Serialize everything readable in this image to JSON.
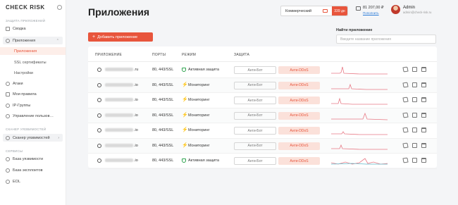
{
  "brand": {
    "logo_left": "CHECK",
    "logo_dot": " ",
    "logo_right": "RISK"
  },
  "sidebar": {
    "section_apps": "ЗАЩИТА ПРИЛОЖЕНИЙ",
    "section_scanner": "СКАНЕР УЯЗВИМОСТЕЙ",
    "section_services": "СЕРВИСЫ",
    "items": {
      "summary": "Сводка",
      "apps": "Приложения",
      "apps_sub": "Приложения",
      "ssl": "SSL сертификаты",
      "settings": "Настройки",
      "attacks": "Атаки",
      "rules": "Мои правила",
      "ip_groups": "IP-Группы",
      "user_mgmt": "Управление пользов…",
      "scanner": "Сканер уязвимостей",
      "vuln_db": "База уязвимости",
      "exploit_db": "База эксплоитов",
      "eol": "EOL"
    }
  },
  "header": {
    "title": "Приложения",
    "plan": "Коммерческий",
    "days": "339 дн",
    "balance": "81 207,00 ₽",
    "topup": "Пополнить",
    "user_name": "Admin",
    "user_email": "admin@check-risk.ru"
  },
  "toolbar": {
    "add_button": "Добавить приложение",
    "search_label": "Найти приложение",
    "search_placeholder": "Введите название приложения"
  },
  "table": {
    "columns": {
      "app": "ПРИЛОЖЕНИЕ",
      "ports": "ПОРТЫ",
      "mode": "РЕЖИМ",
      "protection": "ЗАЩИТА"
    },
    "bot_label": "Анти-Бот",
    "ddos_label": "Анти-DDoS",
    "rows": [
      {
        "suffix": ".ru",
        "ports": "80, 443/SSL",
        "mode": "Активная защита",
        "mode_icon": "shield-icon"
      },
      {
        "suffix": ".io",
        "ports": "80, 443/SSL",
        "mode": "Мониторинг",
        "mode_icon": "pulse-icon"
      },
      {
        "suffix": ".io",
        "ports": "80, 443/SSL",
        "mode": "Мониторинг",
        "mode_icon": "pulse-icon"
      },
      {
        "suffix": ".io",
        "ports": "80, 443/SSL",
        "mode": "Мониторинг",
        "mode_icon": "pulse-icon"
      },
      {
        "suffix": ".io",
        "ports": "80, 443/SSL",
        "mode": "Мониторинг",
        "mode_icon": "pulse-icon"
      },
      {
        "suffix": ".io",
        "ports": "80, 443/SSL",
        "mode": "Мониторинг",
        "mode_icon": "pulse-icon"
      },
      {
        "suffix": ".io",
        "ports": "80, 443/SSL",
        "mode": "Активная защита",
        "mode_icon": "shield-icon"
      }
    ]
  },
  "colors": {
    "accent": "#e8553c",
    "spark_red": "#e87a86",
    "spark_teal": "#5fb8c9",
    "protect_green": "#2ea34d",
    "monitor_blue": "#2a7bd9"
  }
}
